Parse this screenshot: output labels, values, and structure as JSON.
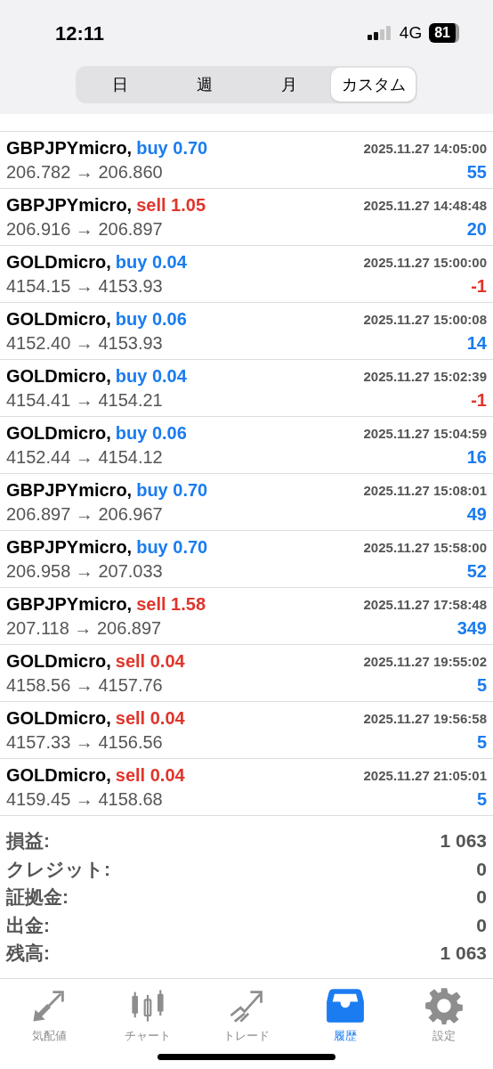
{
  "status_bar": {
    "time": "12:11",
    "network": "4G",
    "battery": "81"
  },
  "period_tabs": [
    {
      "label": "日",
      "selected": false
    },
    {
      "label": "週",
      "selected": false
    },
    {
      "label": "月",
      "selected": false
    },
    {
      "label": "カスタム",
      "selected": true
    }
  ],
  "deals": [
    {
      "symbol": "GBPJPYmicro,",
      "side": {
        "kind": "buy",
        "text": "buy 0.70"
      },
      "time": "2025.11.27 14:05:00",
      "prices": "206.782 → 206.860",
      "profit": {
        "text": "55",
        "color": "#1a7cf0"
      }
    },
    {
      "symbol": "GBPJPYmicro,",
      "side": {
        "kind": "sell",
        "text": "sell 1.05"
      },
      "time": "2025.11.27 14:48:48",
      "prices": "206.916 → 206.897",
      "profit": {
        "text": "20",
        "color": "#1a7cf0"
      }
    },
    {
      "symbol": "GOLDmicro,",
      "side": {
        "kind": "buy",
        "text": "buy 0.04"
      },
      "time": "2025.11.27 15:00:00",
      "prices": "4154.15 → 4153.93",
      "profit": {
        "text": "-1",
        "color": "#e0352b"
      }
    },
    {
      "symbol": "GOLDmicro,",
      "side": {
        "kind": "buy",
        "text": "buy 0.06"
      },
      "time": "2025.11.27 15:00:08",
      "prices": "4152.40 → 4153.93",
      "profit": {
        "text": "14",
        "color": "#1a7cf0"
      }
    },
    {
      "symbol": "GOLDmicro,",
      "side": {
        "kind": "buy",
        "text": "buy 0.04"
      },
      "time": "2025.11.27 15:02:39",
      "prices": "4154.41 → 4154.21",
      "profit": {
        "text": "-1",
        "color": "#e0352b"
      }
    },
    {
      "symbol": "GOLDmicro,",
      "side": {
        "kind": "buy",
        "text": "buy 0.06"
      },
      "time": "2025.11.27 15:04:59",
      "prices": "4152.44 → 4154.12",
      "profit": {
        "text": "16",
        "color": "#1a7cf0"
      }
    },
    {
      "symbol": "GBPJPYmicro,",
      "side": {
        "kind": "buy",
        "text": "buy 0.70"
      },
      "time": "2025.11.27 15:08:01",
      "prices": "206.897 → 206.967",
      "profit": {
        "text": "49",
        "color": "#1a7cf0"
      }
    },
    {
      "symbol": "GBPJPYmicro,",
      "side": {
        "kind": "buy",
        "text": "buy 0.70"
      },
      "time": "2025.11.27 15:58:00",
      "prices": "206.958 → 207.033",
      "profit": {
        "text": "52",
        "color": "#1a7cf0"
      }
    },
    {
      "symbol": "GBPJPYmicro,",
      "side": {
        "kind": "sell",
        "text": "sell 1.58"
      },
      "time": "2025.11.27 17:58:48",
      "prices": "207.118 → 206.897",
      "profit": {
        "text": "349",
        "color": "#1a7cf0"
      }
    },
    {
      "symbol": "GOLDmicro,",
      "side": {
        "kind": "sell",
        "text": "sell 0.04"
      },
      "time": "2025.11.27 19:55:02",
      "prices": "4158.56 → 4157.76",
      "profit": {
        "text": "5",
        "color": "#1a7cf0"
      }
    },
    {
      "symbol": "GOLDmicro,",
      "side": {
        "kind": "sell",
        "text": "sell 0.04"
      },
      "time": "2025.11.27 19:56:58",
      "prices": "4157.33 → 4156.56",
      "profit": {
        "text": "5",
        "color": "#1a7cf0"
      }
    },
    {
      "symbol": "GOLDmicro,",
      "side": {
        "kind": "sell",
        "text": "sell 0.04"
      },
      "time": "2025.11.27 21:05:01",
      "prices": "4159.45 → 4158.68",
      "profit": {
        "text": "5",
        "color": "#1a7cf0"
      }
    }
  ],
  "summary": [
    {
      "label": "損益:",
      "value": "1 063"
    },
    {
      "label": "クレジット:",
      "value": "0"
    },
    {
      "label": "証拠金:",
      "value": "0"
    },
    {
      "label": "出金:",
      "value": "0"
    },
    {
      "label": "残高:",
      "value": "1 063"
    }
  ],
  "tab_bar": [
    {
      "kind": "quotes",
      "label": "気配値",
      "selected": false
    },
    {
      "kind": "chart",
      "label": "チャート",
      "selected": false
    },
    {
      "kind": "trade",
      "label": "トレード",
      "selected": false
    },
    {
      "kind": "history",
      "label": "履歴",
      "selected": true
    },
    {
      "kind": "settings",
      "label": "設定",
      "selected": false
    }
  ]
}
